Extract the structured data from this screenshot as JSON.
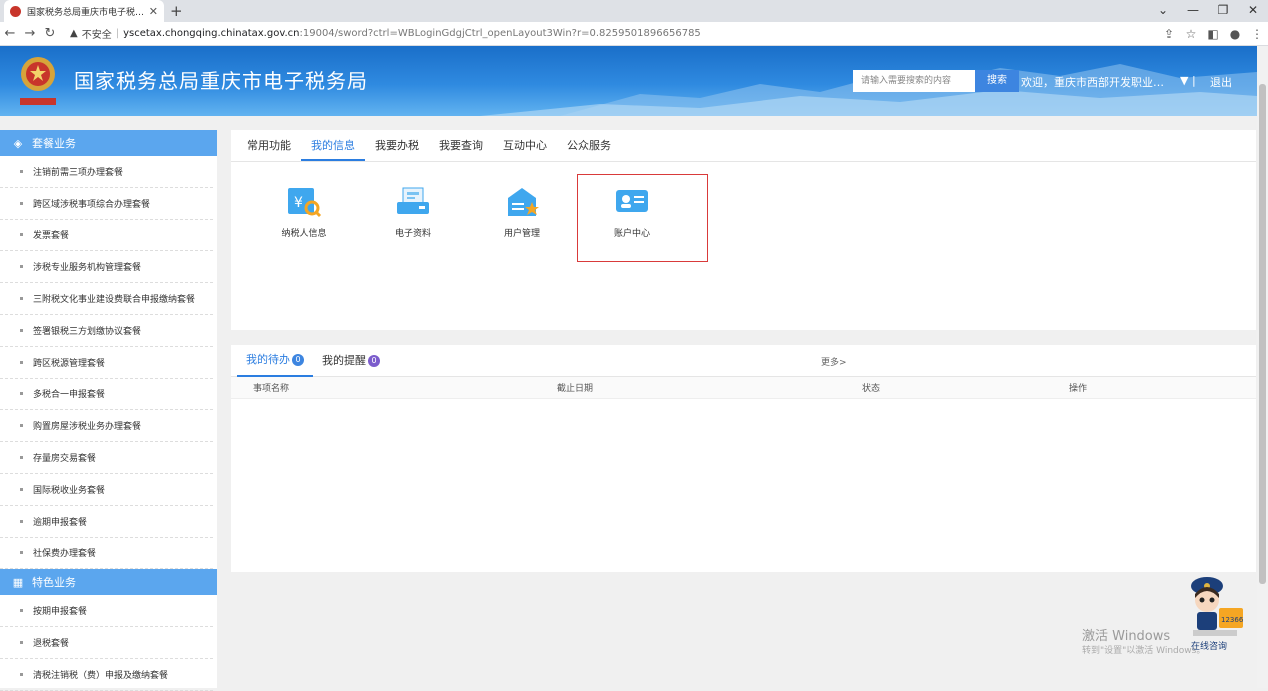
{
  "browser": {
    "tab_title": "国家税务总局重庆市电子税务局",
    "new_tab": "+",
    "close_tab": "✕",
    "insecure_label": "不安全",
    "url_domain": "yscetax.chongqing.chinatax.gov.cn",
    "url_rest": ":19004/sword?ctrl=WBLoginGdgjCtrl_openLayout3Win?r=0.8259501896656785"
  },
  "header": {
    "site_name": "国家税务总局重庆市电子税务局",
    "search_placeholder": "请输入需要搜索的内容",
    "search_button": "搜索",
    "welcome": "欢迎，重庆市西部开发职业培...",
    "logout": "退出"
  },
  "sidebar": {
    "section1": "套餐业务",
    "items1": [
      "注销前需三项办理套餐",
      "跨区域涉税事项综合办理套餐",
      "发票套餐",
      "涉税专业服务机构管理套餐",
      "三附税文化事业建设费联合申报缴纳套餐",
      "签署银税三方划缴协议套餐",
      "跨区税源管理套餐",
      "多税合一申报套餐",
      "购置房屋涉税业务办理套餐",
      "存量房交易套餐",
      "国际税收业务套餐",
      "逾期申报套餐",
      "社保费办理套餐"
    ],
    "section2": "特色业务",
    "items2": [
      "按期申报套餐",
      "退税套餐",
      "清税注销税（费）申报及缴纳套餐"
    ]
  },
  "main": {
    "tabs": [
      "常用功能",
      "我的信息",
      "我要办税",
      "我要查询",
      "互动中心",
      "公众服务"
    ],
    "active_tab": 1,
    "tiles": [
      "纳税人信息",
      "电子资料",
      "用户管理",
      "账户中心"
    ]
  },
  "bottom": {
    "tabs": [
      "我的待办",
      "我的提醒"
    ],
    "todo_count": "0",
    "remind_count": "0",
    "more": "更多>",
    "columns": [
      "事项名称",
      "截止日期",
      "状态",
      "操作"
    ]
  },
  "watermark": {
    "line1": "激活 Windows",
    "line2": "转到\"设置\"以激活 Windows。"
  },
  "mascot": {
    "label": "在线咨询",
    "hotline": "12366"
  }
}
